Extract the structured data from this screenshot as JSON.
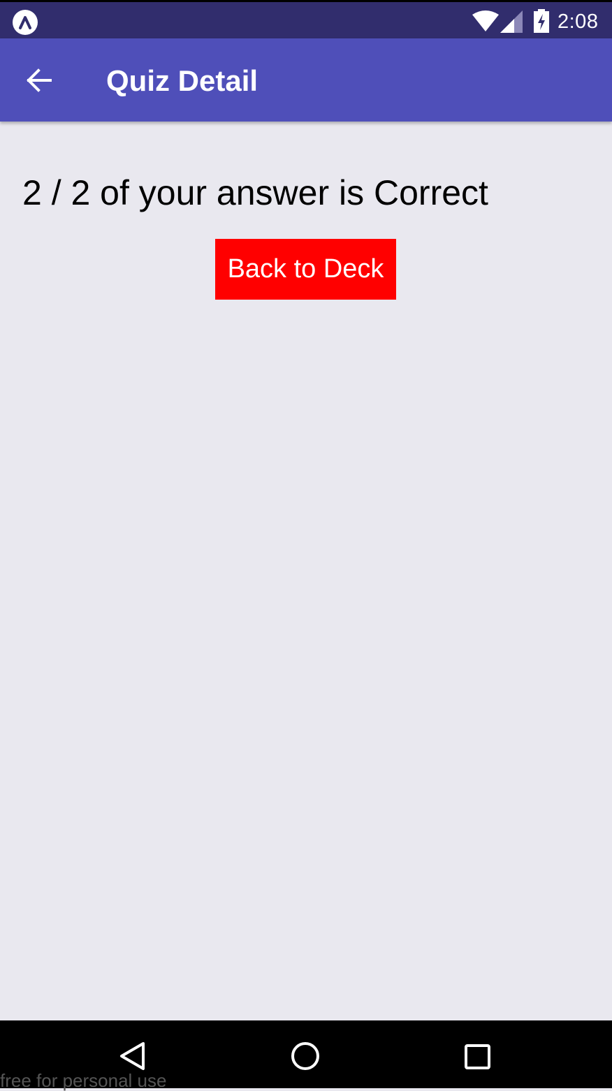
{
  "status_bar": {
    "time": "2:08",
    "icons": [
      "expo-icon",
      "wifi-icon",
      "signal-icon",
      "battery-charging-icon"
    ]
  },
  "app_bar": {
    "back_icon": "arrow-left-icon",
    "title": "Quiz Detail"
  },
  "content": {
    "score_text": "2 / 2 of your answer is Correct",
    "back_to_deck_label": "Back to Deck"
  },
  "nav_bar": {
    "icons": [
      "nav-back-icon",
      "nav-home-icon",
      "nav-recents-icon"
    ]
  },
  "watermark": "free for personal use",
  "colors": {
    "status_bar_bg": "#312d6d",
    "app_bar_bg": "#4f4fb9",
    "page_bg": "#e9e8ef",
    "button_bg": "#ff0000",
    "button_text": "#ffffff"
  }
}
